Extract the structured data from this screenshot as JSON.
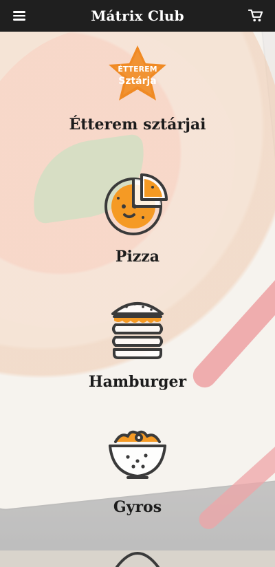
{
  "header": {
    "title": "Mátrix Club",
    "menu_icon": "hamburger-menu-icon",
    "cart_icon": "shopping-cart-icon"
  },
  "badge": {
    "line1": "ÉTTEREM",
    "line2": "Sztárja",
    "color": "#f08a24"
  },
  "categories": [
    {
      "label": "Étterem sztárjai",
      "icon": "star-badge-icon"
    },
    {
      "label": "Pizza",
      "icon": "pizza-icon"
    },
    {
      "label": "Hamburger",
      "icon": "hamburger-icon"
    },
    {
      "label": "Gyros",
      "icon": "gyros-bowl-icon"
    }
  ],
  "colors": {
    "header_bg": "#1f1f1f",
    "accent": "#f59a24",
    "icon_stroke": "#3a3a3a"
  }
}
